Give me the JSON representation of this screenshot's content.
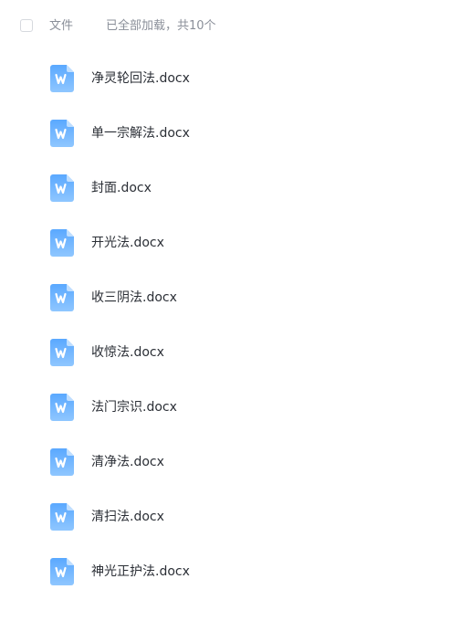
{
  "header": {
    "column_label": "文件",
    "load_status": "已全部加载，共10个"
  },
  "files": [
    {
      "name": "净灵轮回法.docx",
      "icon": "word-doc-icon"
    },
    {
      "name": "单一宗解法.docx",
      "icon": "word-doc-icon"
    },
    {
      "name": "封面.docx",
      "icon": "word-doc-icon"
    },
    {
      "name": "开光法.docx",
      "icon": "word-doc-icon"
    },
    {
      "name": "收三阴法.docx",
      "icon": "word-doc-icon"
    },
    {
      "name": "收惊法.docx",
      "icon": "word-doc-icon"
    },
    {
      "name": "法门宗识.docx",
      "icon": "word-doc-icon"
    },
    {
      "name": "清净法.docx",
      "icon": "word-doc-icon"
    },
    {
      "name": "清扫法.docx",
      "icon": "word-doc-icon"
    },
    {
      "name": "神光正护法.docx",
      "icon": "word-doc-icon"
    }
  ],
  "colors": {
    "icon_top": "#5aa8ff",
    "icon_bottom": "#8fc6ff",
    "icon_fold": "#c9e3ff",
    "text": "#2b2f36",
    "muted": "#8a8f99"
  }
}
